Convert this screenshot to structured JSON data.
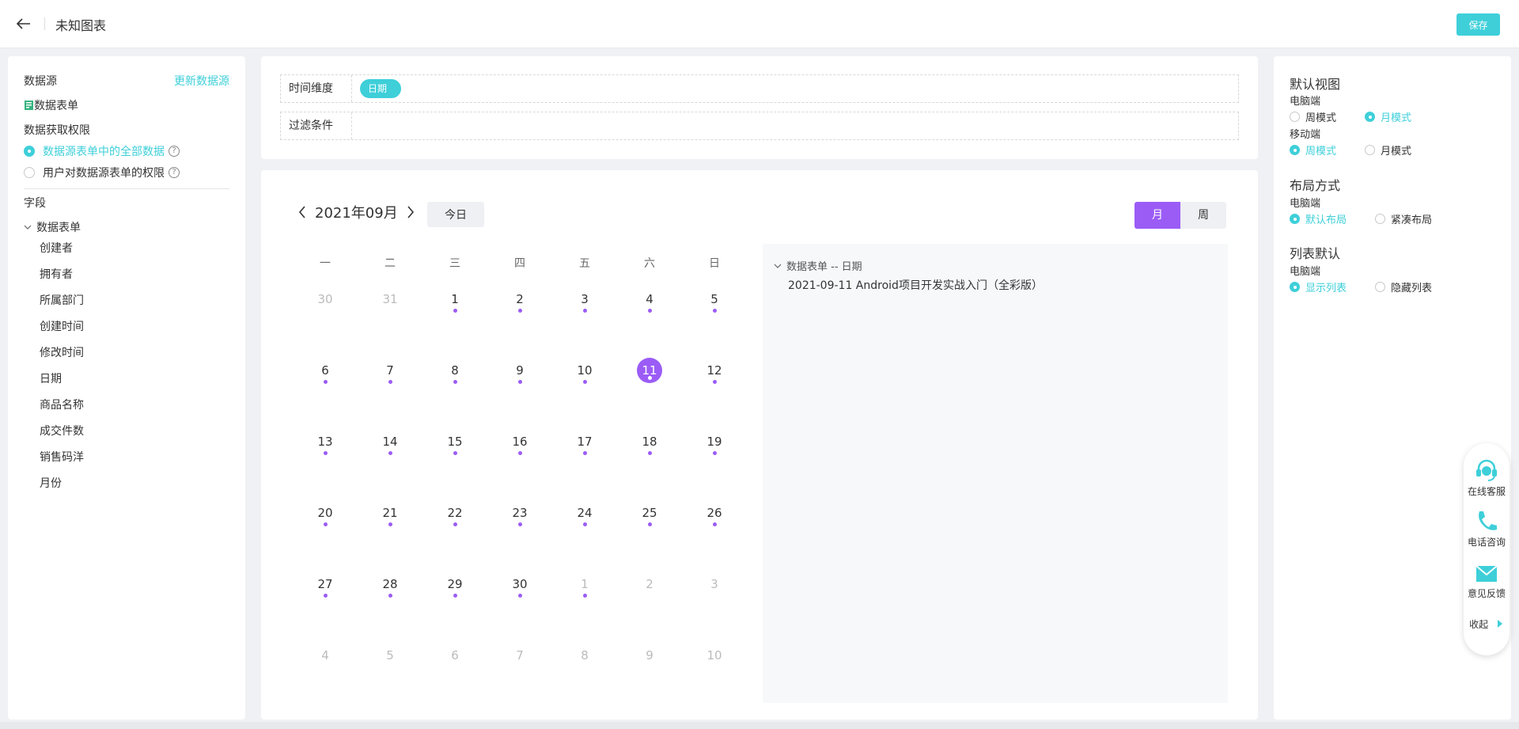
{
  "header": {
    "title": "未知图表",
    "save_label": "保存"
  },
  "datasource": {
    "label": "数据源",
    "update_link": "更新数据源",
    "form_name": "数据表单",
    "permission_label": "数据获取权限",
    "permission_options": [
      {
        "label": "数据源表单中的全部数据",
        "selected": true
      },
      {
        "label": "用户对数据源表单的权限",
        "selected": false
      }
    ]
  },
  "fields": {
    "label": "字段",
    "group": "数据表单",
    "items": [
      "创建者",
      "拥有者",
      "所属部门",
      "创建时间",
      "修改时间",
      "日期",
      "商品名称",
      "成交件数",
      "销售码洋",
      "月份"
    ]
  },
  "config": {
    "time_dim_label": "时间维度",
    "time_dim_value": "日期",
    "filter_label": "过滤条件"
  },
  "calendar": {
    "month_label": "2021年09月",
    "today_label": "今日",
    "view_month": "月",
    "view_week": "周",
    "weekdays": [
      "一",
      "二",
      "三",
      "四",
      "五",
      "六",
      "日"
    ],
    "weeks": [
      [
        {
          "d": "30",
          "f": true,
          "dot": false
        },
        {
          "d": "31",
          "f": true,
          "dot": false
        },
        {
          "d": "1",
          "f": false,
          "dot": true
        },
        {
          "d": "2",
          "f": false,
          "dot": true
        },
        {
          "d": "3",
          "f": false,
          "dot": true
        },
        {
          "d": "4",
          "f": false,
          "dot": true
        },
        {
          "d": "5",
          "f": false,
          "dot": true
        }
      ],
      [
        {
          "d": "6",
          "f": false,
          "dot": true
        },
        {
          "d": "7",
          "f": false,
          "dot": true
        },
        {
          "d": "8",
          "f": false,
          "dot": true
        },
        {
          "d": "9",
          "f": false,
          "dot": true
        },
        {
          "d": "10",
          "f": false,
          "dot": true
        },
        {
          "d": "11",
          "f": false,
          "dot": true,
          "sel": true
        },
        {
          "d": "12",
          "f": false,
          "dot": true
        }
      ],
      [
        {
          "d": "13",
          "f": false,
          "dot": true
        },
        {
          "d": "14",
          "f": false,
          "dot": true
        },
        {
          "d": "15",
          "f": false,
          "dot": true
        },
        {
          "d": "16",
          "f": false,
          "dot": true
        },
        {
          "d": "17",
          "f": false,
          "dot": true
        },
        {
          "d": "18",
          "f": false,
          "dot": true
        },
        {
          "d": "19",
          "f": false,
          "dot": true
        }
      ],
      [
        {
          "d": "20",
          "f": false,
          "dot": true
        },
        {
          "d": "21",
          "f": false,
          "dot": true
        },
        {
          "d": "22",
          "f": false,
          "dot": true
        },
        {
          "d": "23",
          "f": false,
          "dot": true
        },
        {
          "d": "24",
          "f": false,
          "dot": true
        },
        {
          "d": "25",
          "f": false,
          "dot": true
        },
        {
          "d": "26",
          "f": false,
          "dot": true
        }
      ],
      [
        {
          "d": "27",
          "f": false,
          "dot": true
        },
        {
          "d": "28",
          "f": false,
          "dot": true
        },
        {
          "d": "29",
          "f": false,
          "dot": true
        },
        {
          "d": "30",
          "f": false,
          "dot": true
        },
        {
          "d": "1",
          "f": true,
          "dot": true
        },
        {
          "d": "2",
          "f": true,
          "dot": false
        },
        {
          "d": "3",
          "f": true,
          "dot": false
        }
      ],
      [
        {
          "d": "4",
          "f": true,
          "dot": false
        },
        {
          "d": "5",
          "f": true,
          "dot": false
        },
        {
          "d": "6",
          "f": true,
          "dot": false
        },
        {
          "d": "7",
          "f": true,
          "dot": false
        },
        {
          "d": "8",
          "f": true,
          "dot": false
        },
        {
          "d": "9",
          "f": true,
          "dot": false
        },
        {
          "d": "10",
          "f": true,
          "dot": false
        }
      ]
    ],
    "event_group": "数据表单 -- 日期",
    "event_item": "2021-09-11 Android项目开发实战入门（全彩版）"
  },
  "settings": {
    "default_view": "默认视图",
    "pc": "电脑端",
    "mobile": "移动端",
    "week_mode": "周模式",
    "month_mode": "月模式",
    "layout": "布局方式",
    "layout_default": "默认布局",
    "layout_compact": "紧凑布局",
    "list_default": "列表默认",
    "show_list": "显示列表",
    "hide_list": "隐藏列表"
  },
  "helper": {
    "online": "在线客服",
    "phone": "电话咨询",
    "feedback": "意见反馈",
    "collapse": "收起"
  },
  "colors": {
    "accent": "#3ecfd9",
    "purple": "#9b5cf6"
  }
}
